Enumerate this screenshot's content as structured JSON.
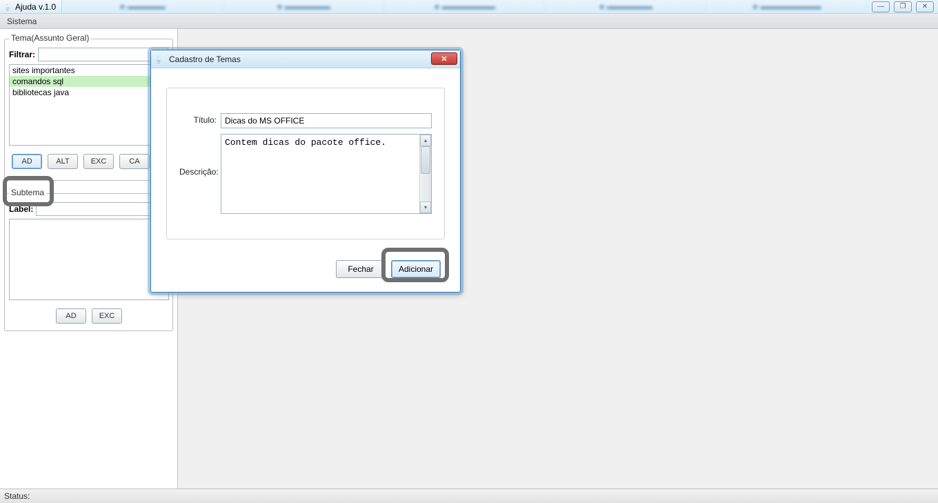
{
  "taskbar": {
    "app_title": "Ajuda v.1.0",
    "win_controls": {
      "min": "—",
      "max": "❐",
      "close": "✕"
    }
  },
  "menubar": {
    "sistema": "Sistema"
  },
  "sidebar": {
    "tema_legend": "Tema(Assunto Geral)",
    "filtrar_label": "Filtrar:",
    "filtrar_value": "",
    "tema_items": [
      "sites importantes",
      "comandos sql",
      "bibliotecas java"
    ],
    "tema_selected_index": 1,
    "tema_buttons": {
      "ad": "AD",
      "alt": "ALT",
      "exc": "EXC",
      "ca": "CA"
    },
    "subtema_legend": "Subtema",
    "label_label": "Label:",
    "label_value": "",
    "subtema_buttons": {
      "ad": "AD",
      "exc": "EXC"
    }
  },
  "dialog": {
    "title": "Cadastro de Temas",
    "titulo_label": "Título:",
    "titulo_value": "Dicas do MS OFFICE",
    "descricao_label": "Descrição:",
    "descricao_value": "Contem dicas do pacote office.",
    "fechar": "Fechar",
    "adicionar": "Adicionar"
  },
  "statusbar": {
    "label": "Status:"
  }
}
